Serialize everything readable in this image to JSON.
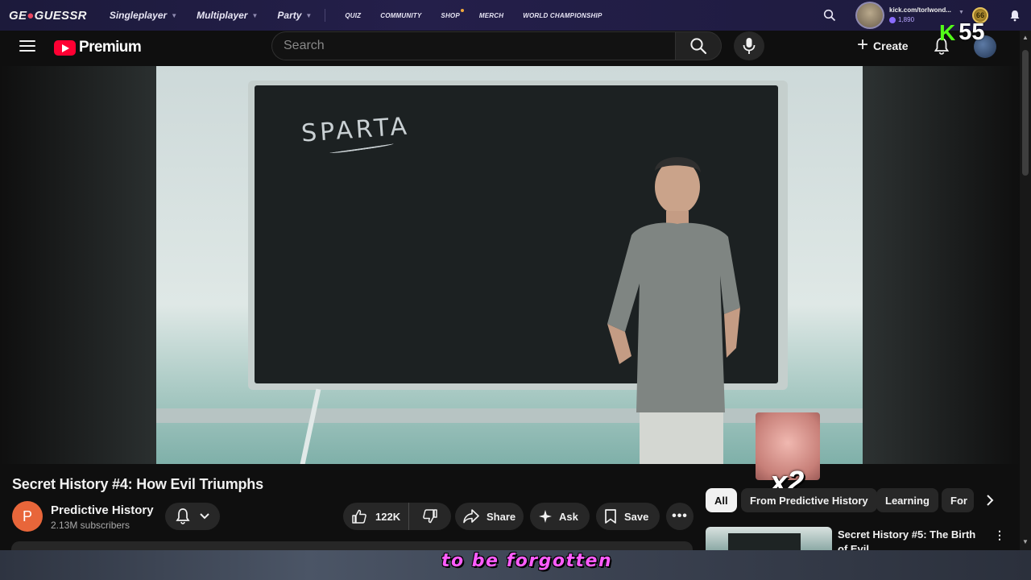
{
  "overlay": {
    "logo_prefix": "GE",
    "logo_suffix": "GUESSR",
    "nav_main": [
      "Singleplayer",
      "Multiplayer",
      "Party"
    ],
    "nav_small": [
      "QUIZ",
      "COMMUNITY",
      "SHOP",
      "MERCH",
      "WORLD CHAMPIONSHIP"
    ],
    "username": "kick.com/torlwond...",
    "coins": "1,890",
    "level": "66"
  },
  "youtube": {
    "logo_text": "Premium",
    "search_placeholder": "Search",
    "create_label": "Create",
    "kick_letter": "K",
    "kick_count": "55"
  },
  "video": {
    "board_text": "SPARTA",
    "title": "Secret History #4: How Evil Triumphs",
    "channel_initial": "P",
    "channel_name": "Predictive History",
    "subscribers": "2.13M subscribers",
    "likes": "122K",
    "share_label": "Share",
    "ask_label": "Ask",
    "save_label": "Save",
    "reaction_label": "x2"
  },
  "chips": [
    "All",
    "From Predictive History",
    "Learning",
    "For"
  ],
  "recommendation": {
    "title": "Secret History #5: The Birth of Evil"
  },
  "caption": "to be forgotten"
}
